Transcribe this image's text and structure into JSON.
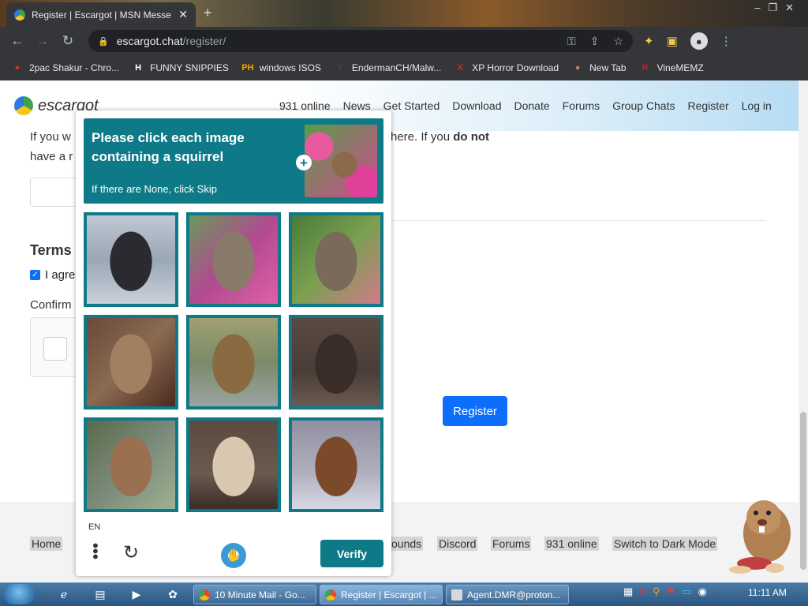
{
  "browser": {
    "tab_title": "Register | Escargot | MSN Messe",
    "url_host": "escargot.chat",
    "url_path": "/register/",
    "bookmarks": [
      {
        "label": "2pac Shakur - Chro...",
        "icon": "bag-icon",
        "icon_text": "",
        "color": "#c0392b"
      },
      {
        "label": "FUNNY SNIPPIES",
        "icon": "h-icon",
        "icon_text": "H",
        "color": "#ffffff"
      },
      {
        "label": "windows ISOS",
        "icon": "ph-icon",
        "icon_text": "PH",
        "color": "#f7a400"
      },
      {
        "label": "EndermanCH/Malw...",
        "icon": "yp-icon",
        "icon_text": "Y",
        "color": "#444444"
      },
      {
        "label": "XP Horror Download",
        "icon": "x-icon",
        "icon_text": "X",
        "color": "#e02020"
      },
      {
        "label": "New Tab",
        "icon": "globe-icon",
        "icon_text": "",
        "color": "#c08070"
      },
      {
        "label": "VineMEMZ",
        "icon": "r-icon",
        "icon_text": "R",
        "color": "#c0202a"
      }
    ]
  },
  "site": {
    "logo_text": "escargot",
    "nav": [
      "931 online",
      "News",
      "Get Started",
      "Download",
      "Donate",
      "Forums",
      "Group Chats",
      "Register",
      "Log in"
    ],
    "line1_left": "If you w",
    "line1_right_pre": "here. If you ",
    "line1_right_bold": "do not",
    "line2_left": "have a r",
    "terms_heading": "Terms",
    "agree_text": "I agre",
    "confirm_label": "Confirm",
    "register_button": "Register",
    "footer_links": [
      "Home",
      "ounds",
      "Discord",
      "Forums",
      "931 online",
      "Switch to Dark Mode"
    ]
  },
  "captcha": {
    "title": "Please click each image containing a squirrel",
    "subtitle": "If there are None, click Skip",
    "language": "EN",
    "verify_label": "Verify",
    "tiles": [
      {
        "name": "captcha-tile-rabbit-water",
        "bg": "linear-gradient(180deg,#bfc8d4 0%,#9aa7b5 50%,#c9d1db 100%)",
        "fg": "#2a2a30"
      },
      {
        "name": "captcha-tile-squirrel-flowers",
        "bg": "linear-gradient(135deg,#6a9a5a 0%,#b04a90 50%,#e060a8 100%)",
        "fg": "#8a7a6a"
      },
      {
        "name": "captcha-tile-squirrel-garden",
        "bg": "linear-gradient(135deg,#4a7a3a 0%,#7aa050 50%,#d07a8a 100%)",
        "fg": "#7a6a5a"
      },
      {
        "name": "captcha-tile-squirrel-apple",
        "bg": "linear-gradient(135deg,#6a4a3a 0%,#8a6a50 50%,#4a2a20 100%)",
        "fg": "#a08060"
      },
      {
        "name": "captcha-tile-rabbit-pond",
        "bg": "linear-gradient(180deg,#a0a070 0%,#7a8a6a 50%,#9aa5a0 100%)",
        "fg": "#8a6a40"
      },
      {
        "name": "captcha-tile-dark-animal",
        "bg": "linear-gradient(180deg,#5a4a44 0%,#4a3c36 60%,#6a5a54 100%)",
        "fg": "#3a2c26"
      },
      {
        "name": "captcha-tile-squirrel-tree",
        "bg": "linear-gradient(135deg,#5a6a4a 0%,#7a8a7a 50%,#a0b090 100%)",
        "fg": "#9a7050"
      },
      {
        "name": "captcha-tile-rabbit-sitting",
        "bg": "linear-gradient(180deg,#5a4a40 0%,#6a5a4e 60%,#3a2e28 100%)",
        "fg": "#d8c8b0"
      },
      {
        "name": "captcha-tile-rabbit-snow",
        "bg": "linear-gradient(180deg,#9090a0 0%,#b0b0c0 60%,#d8d8e4 100%)",
        "fg": "#7a4a2a"
      }
    ]
  },
  "taskbar": {
    "windows": [
      "10 Minute Mail - Go...",
      "Register | Escargot | ...",
      "Agent.DMR@proton..."
    ],
    "time": "11:11 AM"
  }
}
